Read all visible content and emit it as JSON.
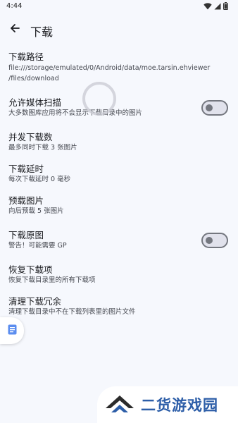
{
  "status_bar": {
    "time": "4:44",
    "icons": [
      "wifi-icon",
      "signal-icon",
      "battery-icon"
    ]
  },
  "app_bar": {
    "title": "下载",
    "back_icon": "arrow-left-icon"
  },
  "settings": {
    "download_path": {
      "title": "下载路径",
      "path_line1": "file:///storage/emulated/0/Android/data/moe.tarsin.ehviewer",
      "path_line2": "/files/download"
    },
    "media_scan": {
      "title": "允许媒体扫描",
      "subtitle": "大多数图库应用将不会显示下载目录中的图片",
      "enabled": false
    },
    "concurrent": {
      "title": "并发下载数",
      "subtitle": "最多同时下载 3 张图片"
    },
    "delay": {
      "title": "下载延时",
      "subtitle": "每次下载延时 0 毫秒"
    },
    "preload": {
      "title": "预载图片",
      "subtitle": "向后预载 5 张图片"
    },
    "original": {
      "title": "下载原图",
      "subtitle": "警告！可能需要 GP",
      "enabled": false
    },
    "restore": {
      "title": "恢复下载项",
      "subtitle": "恢复下载目录里的所有下载项"
    },
    "clean": {
      "title": "清理下载冗余",
      "subtitle": "清理下载目录中不在下载列表里的图片文件"
    }
  },
  "watermark": {
    "text": "二货游戏园",
    "colors": {
      "text": "#2d5ea8",
      "logo_dark": "#2b2b2b",
      "logo_accent": "#2d5ea8"
    }
  },
  "colors": {
    "background": "#f6f8fd",
    "title": "#1b1c20",
    "subtitle": "#44474f",
    "toggle_outline": "#74777f"
  }
}
